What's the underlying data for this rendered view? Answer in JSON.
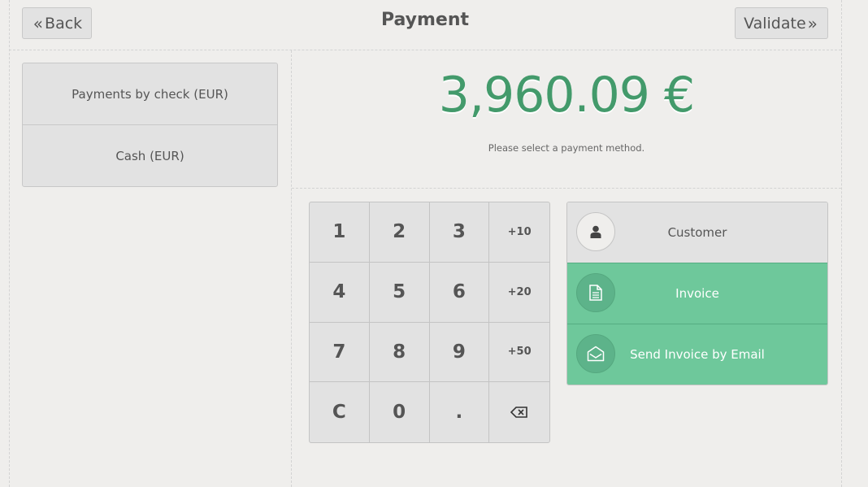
{
  "header": {
    "title": "Payment",
    "back_label": "Back",
    "back_icon": "double-chevron-left",
    "validate_label": "Validate",
    "validate_icon": "double-chevron-right"
  },
  "payment_methods": [
    {
      "label": "Payments by check (EUR)"
    },
    {
      "label": "Cash (EUR)"
    }
  ],
  "summary": {
    "amount": "3,960.09 €",
    "hint": "Please select a payment method."
  },
  "numpad": {
    "keys": [
      "1",
      "2",
      "3",
      "+10",
      "4",
      "5",
      "6",
      "+20",
      "7",
      "8",
      "9",
      "+50",
      "C",
      "0",
      ".",
      "⌫"
    ]
  },
  "actions": [
    {
      "label": "Customer",
      "icon": "user-icon",
      "state": "default"
    },
    {
      "label": "Invoice",
      "icon": "document-icon",
      "state": "active"
    },
    {
      "label": "Send Invoice by Email",
      "icon": "envelope-open-icon",
      "state": "active"
    }
  ],
  "colors": {
    "accent_green": "#439a6b",
    "active_button": "#6ec89b",
    "background": "#efeeec"
  }
}
